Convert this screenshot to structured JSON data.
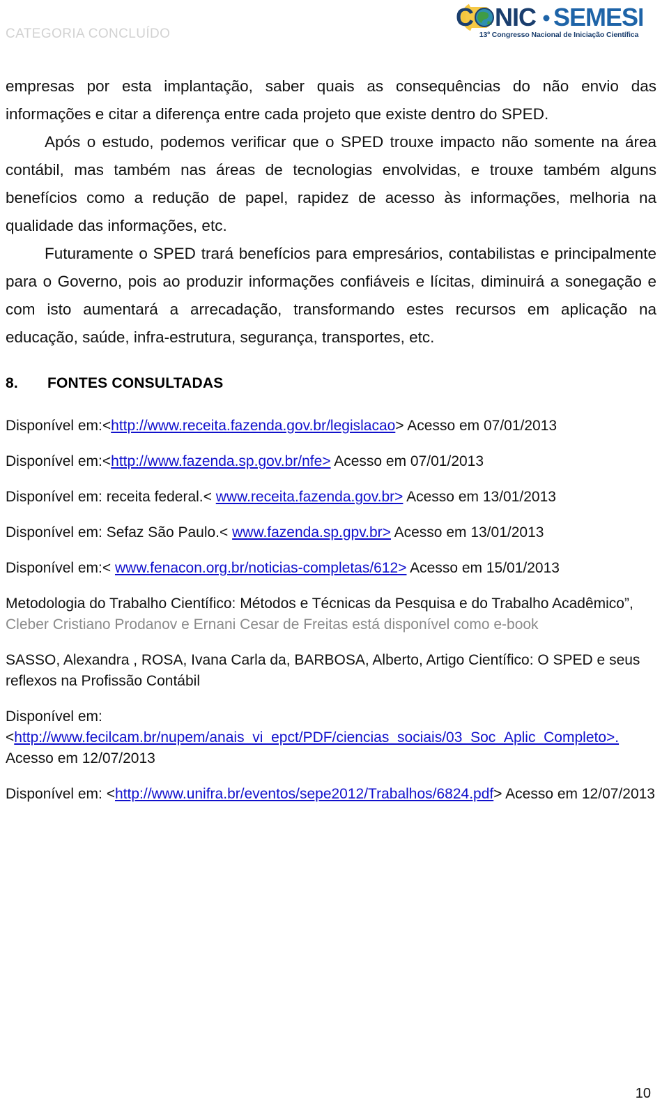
{
  "header": {
    "category_tag": "CATEGORIA CONCLUÍDO",
    "logo": {
      "wordmark_part1": "C",
      "wordmark_part2": "NIC",
      "wordmark_separator": "•",
      "wordmark_part3": "SEMESP",
      "subtitle": "13º Congresso Nacional de Iniciação Científica",
      "colors": {
        "dark_blue": "#1a3e6e",
        "teal": "#2b7f9e",
        "yellow": "#f2c230",
        "green": "#3a8a3f"
      }
    }
  },
  "body": {
    "paragraph_1": "empresas por esta implantação, saber quais as consequências do não envio das informações e citar a diferença entre cada projeto que existe dentro do SPED.",
    "paragraph_2": "Após o estudo, podemos verificar que o SPED trouxe impacto não somente na área contábil, mas também nas áreas de tecnologias envolvidas, e trouxe também alguns benefícios como a redução de papel, rapidez de acesso às informações, melhoria na qualidade das informações, etc.",
    "paragraph_3": "Futuramente o SPED trará benefícios para empresários, contabilistas e principalmente para o Governo, pois ao produzir informações confiáveis e lícitas, diminuirá a sonegação e com isto aumentará a arrecadação, transformando estes recursos em aplicação na educação, saúde, infra-estrutura, segurança, transportes, etc."
  },
  "section": {
    "number": "8.",
    "title": "FONTES CONSULTADAS"
  },
  "references": {
    "ref1": {
      "prefix": "Disponível em:<",
      "url": "http://www.receita.fazenda.gov.br/legislacao",
      "suffix": "> Acesso em 07/01/2013"
    },
    "ref2": {
      "prefix": "Disponível em:<",
      "url": "http://www.fazenda.sp.gov.br/nfe>",
      "suffix": " Acesso em 07/01/2013"
    },
    "ref3": {
      "prefix": "Disponível em: receita federal.<",
      "url": "www.receita.fazenda.gov.br>",
      "suffix": " Acesso em 13/01/2013"
    },
    "ref4": {
      "prefix": "Disponível em: Sefaz São Paulo.<",
      "url": "www.fazenda.sp.gpv.br>",
      "suffix": " Acesso em 13/01/2013"
    },
    "ref5": {
      "prefix": "Disponível em:<",
      "url": "www.fenacon.org.br/noticias-completas/612>",
      "suffix": " Acesso em 15/01/2013"
    },
    "ref6": {
      "title_black": "Metodologia do Trabalho Científico: Métodos e Técnicas da Pesquisa e do Trabalho Acadêmico”,",
      "authors_gray": " Cleber Cristiano Prodanov e Ernani Cesar de Freitas está disponível como e-book"
    },
    "ref7": {
      "text": "SASSO, Alexandra , ROSA, Ivana Carla da, BARBOSA, Alberto, Artigo Científico: O SPED e seus reflexos na Profissão Contábil"
    },
    "ref8": {
      "label": "Disponível em:",
      "open_bracket": "<",
      "url": "http://www.fecilcam.br/nupem/anais_vi_epct/PDF/ciencias_sociais/03_Soc_Aplic_Completo>.",
      "suffix": " Acesso em 12/07/2013"
    },
    "ref9": {
      "prefix": "Disponível em: <",
      "url": "http://www.unifra.br/eventos/sepe2012/Trabalhos/6824.pdf",
      "suffix": "> Acesso em 12/07/2013"
    }
  },
  "footer": {
    "page_number": "10"
  }
}
